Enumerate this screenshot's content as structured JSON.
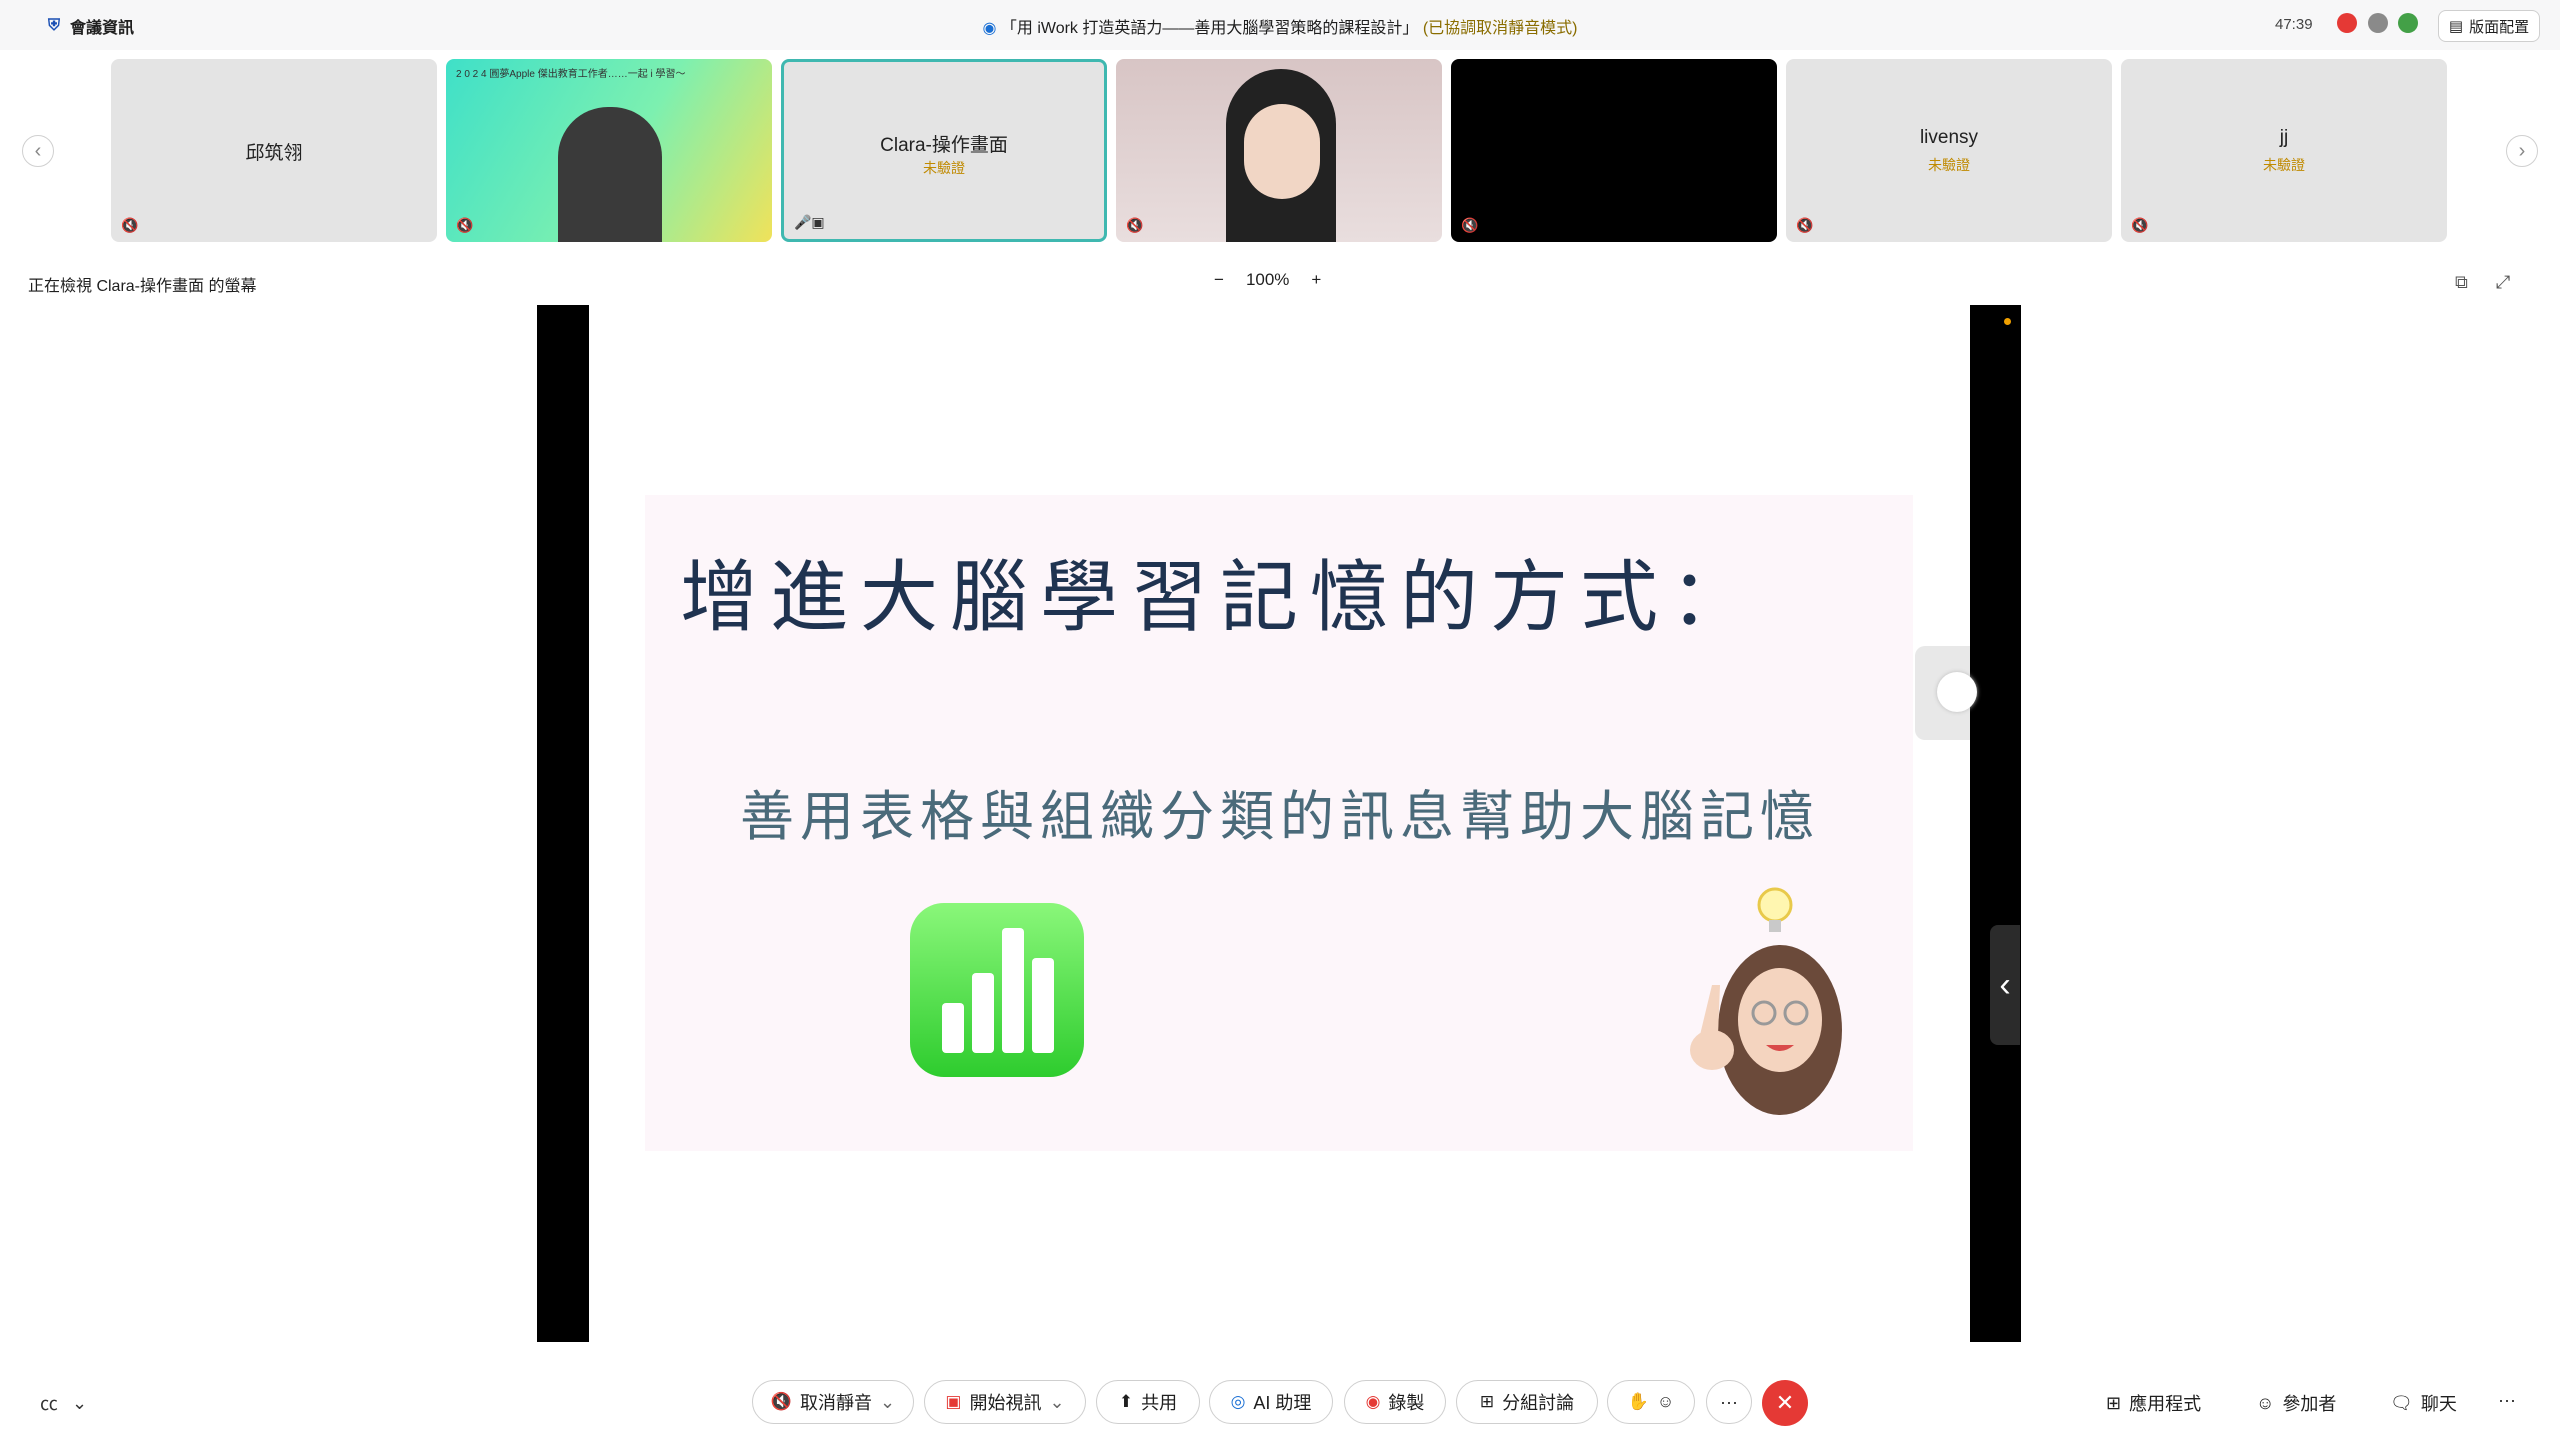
{
  "topbar": {
    "meeting_info": "會議資訊",
    "title_main": "「用 iWork 打造英語力——善用大腦學習策略的課程設計」",
    "title_note": "(已協調取消靜音模式)",
    "timer": "47:39",
    "layout_button": "版面配置",
    "colors": {
      "red": "#e53935",
      "gray": "#8a8a8a",
      "green": "#43a047"
    }
  },
  "participants": [
    {
      "name": "邱筑翎",
      "unverified": ""
    },
    {
      "name": "",
      "unverified": "",
      "video_text": "2 0 2 4 圓夢Apple 傑出教育工作者……一起 i 學習～"
    },
    {
      "name": "Clara-操作畫面",
      "unverified": "未驗證"
    },
    {
      "name": "",
      "unverified": ""
    },
    {
      "name": "",
      "unverified": ""
    },
    {
      "name": "livensy",
      "unverified": "未驗證"
    },
    {
      "name": "jj",
      "unverified": "未驗證"
    }
  ],
  "viewing_label": "正在檢視 Clara-操作畫面 的螢幕",
  "zoom": {
    "minus": "−",
    "value": "100%",
    "plus": "+"
  },
  "slide": {
    "title": "增進大腦學習記憶的方式：",
    "subtitle": "善用表格與組織分類的訊息幫助大腦記憶"
  },
  "toolbar": {
    "unmute": "取消靜音",
    "start_video": "開始視訊",
    "share": "共用",
    "ai_assistant": "AI 助理",
    "record": "錄製",
    "breakout": "分組討論",
    "more": "···",
    "apps": "應用程式",
    "participants": "參加者",
    "chat": "聊天",
    "right_more": "···"
  }
}
